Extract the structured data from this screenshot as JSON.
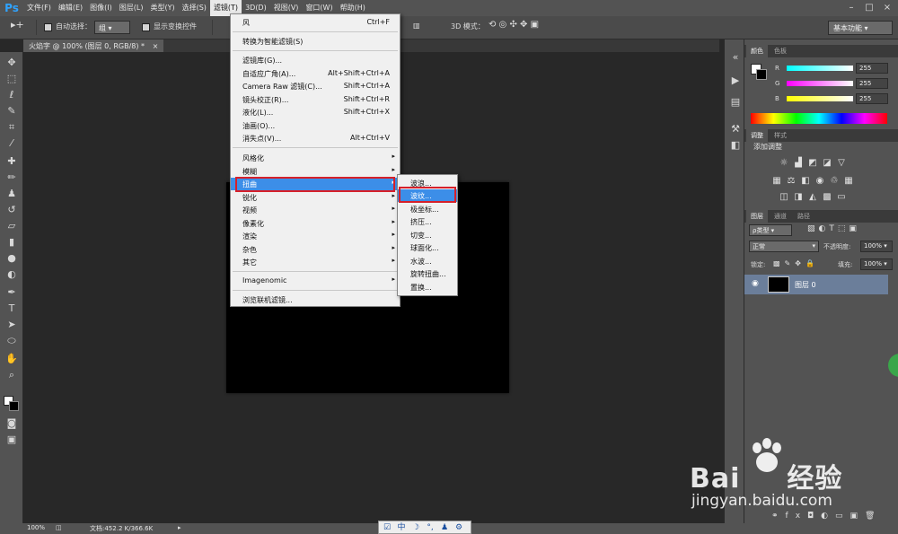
{
  "app": {
    "logo": "Ps"
  },
  "menubar": {
    "items": [
      "文件(F)",
      "编辑(E)",
      "图像(I)",
      "图层(L)",
      "类型(Y)",
      "选择(S)",
      "滤镜(T)",
      "3D(D)",
      "视图(V)",
      "窗口(W)",
      "帮助(H)"
    ],
    "active_index": 6
  },
  "options": {
    "auto_select": "自动选择：",
    "auto_select_value": "组",
    "show_transform": "显示变换控件",
    "mode_3d": "3D 模式：",
    "workspace": "基本功能"
  },
  "document": {
    "tab_label": "火焰字 @ 100% (图层 0, RGB/8) *",
    "close": "×"
  },
  "filter_menu": {
    "items": [
      {
        "label": "风",
        "shortcut": "Ctrl+F"
      },
      {
        "label": "转换为智能滤镜(S)",
        "shortcut": ""
      },
      {
        "label": "滤镜库(G)...",
        "shortcut": ""
      },
      {
        "label": "自适应广角(A)...",
        "shortcut": "Alt+Shift+Ctrl+A"
      },
      {
        "label": "Camera Raw 滤镜(C)...",
        "shortcut": "Shift+Ctrl+A"
      },
      {
        "label": "镜头校正(R)...",
        "shortcut": "Shift+Ctrl+R"
      },
      {
        "label": "液化(L)...",
        "shortcut": "Shift+Ctrl+X"
      },
      {
        "label": "油画(O)...",
        "shortcut": ""
      },
      {
        "label": "消失点(V)...",
        "shortcut": "Alt+Ctrl+V"
      },
      {
        "label": "风格化",
        "shortcut": ""
      },
      {
        "label": "模糊",
        "shortcut": ""
      },
      {
        "label": "扭曲",
        "shortcut": ""
      },
      {
        "label": "锐化",
        "shortcut": ""
      },
      {
        "label": "视频",
        "shortcut": ""
      },
      {
        "label": "像素化",
        "shortcut": ""
      },
      {
        "label": "渲染",
        "shortcut": ""
      },
      {
        "label": "杂色",
        "shortcut": ""
      },
      {
        "label": "其它",
        "shortcut": ""
      },
      {
        "label": "Imagenomic",
        "shortcut": ""
      },
      {
        "label": "浏览联机滤镜...",
        "shortcut": ""
      }
    ],
    "submenu_arrow": "▸"
  },
  "distort_submenu": {
    "items": [
      "波浪...",
      "波纹...",
      "极坐标...",
      "挤压...",
      "切变...",
      "球面化...",
      "水波...",
      "旋转扭曲...",
      "置换..."
    ],
    "highlighted_index": 1
  },
  "color_panel": {
    "tabs": [
      "颜色",
      "色板"
    ],
    "channels": [
      {
        "label": "R",
        "value": "255"
      },
      {
        "label": "G",
        "value": "255"
      },
      {
        "label": "B",
        "value": "255"
      }
    ]
  },
  "adjustments_panel": {
    "tabs": [
      "调整",
      "样式"
    ],
    "heading": "添加调整"
  },
  "layers_panel": {
    "tabs": [
      "图层",
      "通道",
      "路径"
    ],
    "filter_kind": "ρ类型",
    "blend_mode": "正常",
    "opacity_label": "不透明度:",
    "opacity_value": "100%",
    "lock_label": "锁定:",
    "fill_label": "填充:",
    "fill_value": "100%",
    "layers": [
      {
        "name": "图层 0",
        "visible": true
      }
    ]
  },
  "status": {
    "zoom": "100%",
    "doc_info": "文档:452.2 K/366.6K"
  },
  "watermark": {
    "brand": "Bai",
    "brand_suffix": "经验",
    "url": "jingyan.baidu.com"
  },
  "taskbar": {
    "ime": "中"
  },
  "colors": {
    "accent_highlight": "#3c8ee8",
    "red_annotation": "#d6202a",
    "ui_dark": "#535353"
  }
}
